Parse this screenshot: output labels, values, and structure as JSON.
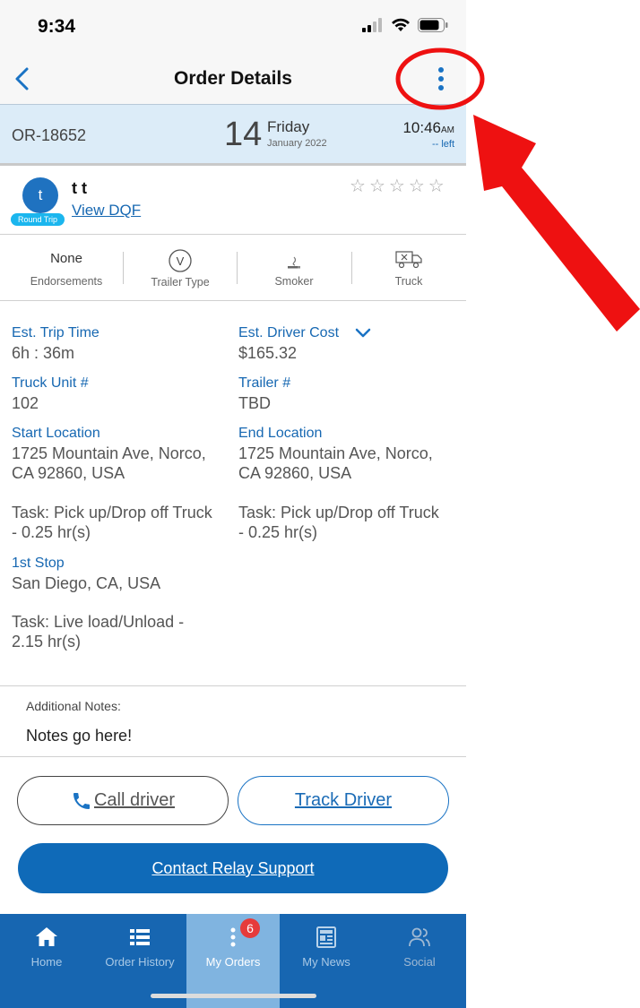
{
  "status_bar": {
    "time": "9:34"
  },
  "nav": {
    "title": "Order Details"
  },
  "order": {
    "number": "OR-18652",
    "day": "14",
    "weekday": "Friday",
    "month_year": "January 2022",
    "time": "10:46",
    "ampm": "AM",
    "remaining": "-- left"
  },
  "driver": {
    "initial": "t",
    "name": "t t",
    "badge": "Round Trip",
    "link": "View DQF",
    "rating_stars": [
      "☆",
      "☆",
      "☆",
      "☆",
      "☆"
    ]
  },
  "attributes": {
    "endorsements_value": "None",
    "endorsements_label": "Endorsements",
    "trailer_type_icon_letter": "V",
    "trailer_type_label": "Trailer Type",
    "smoker_label": "Smoker",
    "truck_label": "Truck"
  },
  "details": {
    "trip_time_label": "Est. Trip Time",
    "trip_time_value": "6h : 36m",
    "driver_cost_label": "Est. Driver Cost",
    "driver_cost_value": "$165.32",
    "truck_unit_label": "Truck Unit #",
    "truck_unit_value": "102",
    "trailer_label": "Trailer #",
    "trailer_value": "TBD",
    "start_label": "Start Location",
    "start_line1": "1725 Mountain Ave, Norco,",
    "start_line2": "CA 92860, USA",
    "end_label": "End Location",
    "end_line1": "1725 Mountain Ave, Norco,",
    "end_line2": "CA 92860, USA",
    "start_task_line1": "Task: Pick up/Drop off Truck",
    "start_task_line2": "- 0.25 hr(s)",
    "end_task_line1": "Task: Pick up/Drop off Truck",
    "end_task_line2": "- 0.25 hr(s)",
    "stop_label": "1st Stop",
    "stop_value": "San Diego, CA, USA",
    "stop_task_line1": "Task: Live load/Unload -",
    "stop_task_line2": "2.15 hr(s)"
  },
  "notes": {
    "label": "Additional Notes:",
    "value": "Notes go here!"
  },
  "actions": {
    "call_label": "Call driver",
    "track_label": "Track Driver",
    "relay_label": "Contact Relay Support"
  },
  "tabbar": {
    "tabs": [
      {
        "label": "Home",
        "icon": "home-icon"
      },
      {
        "label": "Order History",
        "icon": "list-icon"
      },
      {
        "label": "My Orders",
        "icon": "vertical-dots-icon"
      },
      {
        "label": "My News",
        "icon": "newspaper-icon"
      },
      {
        "label": "Social",
        "icon": "people-icon"
      }
    ],
    "my_orders_badge": "6"
  },
  "colors": {
    "accent": "#1768b2",
    "header_bg": "#dcecf8",
    "tabbar_bg": "#1766b1",
    "annotation": "#ee1111"
  }
}
